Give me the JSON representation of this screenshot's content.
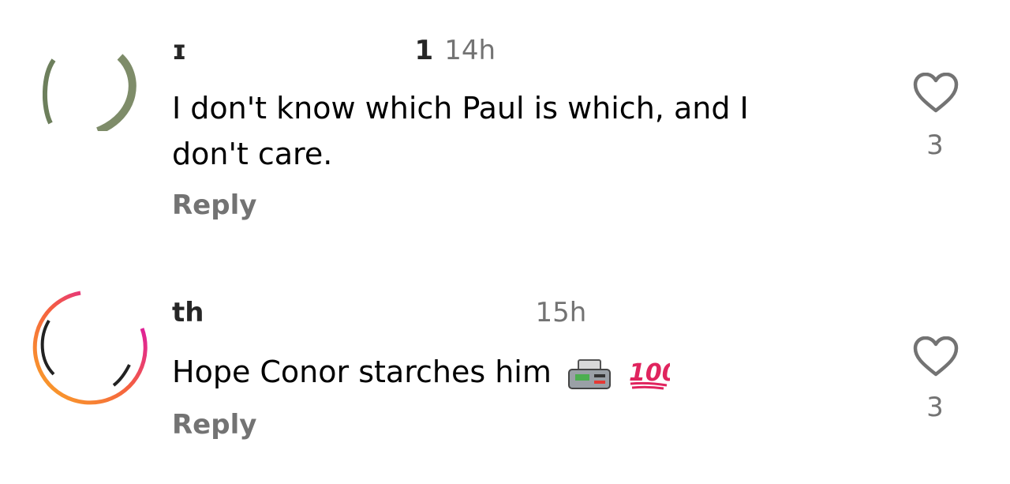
{
  "comments": [
    {
      "username": "ɪ         1",
      "time": "14h",
      "text": "I don't know which Paul is which, and I don't care.",
      "reply_label": "Reply",
      "like_count": "3",
      "like_icon": "heart-outline-icon",
      "avatar_icon": "avatar-image"
    },
    {
      "username": "th          ",
      "time": "15h",
      "text": "Hope Conor starches him",
      "emojis": [
        "fax-machine-emoji",
        "hundred-points-emoji"
      ],
      "reply_label": "Reply",
      "like_count": "3",
      "like_icon": "heart-outline-icon",
      "avatar_icon": "avatar-story-ring"
    }
  ],
  "colors": {
    "secondary_text": "#737373",
    "primary_text": "#000000",
    "story_ring_start": "#f9a825",
    "story_ring_end": "#d300c5"
  }
}
